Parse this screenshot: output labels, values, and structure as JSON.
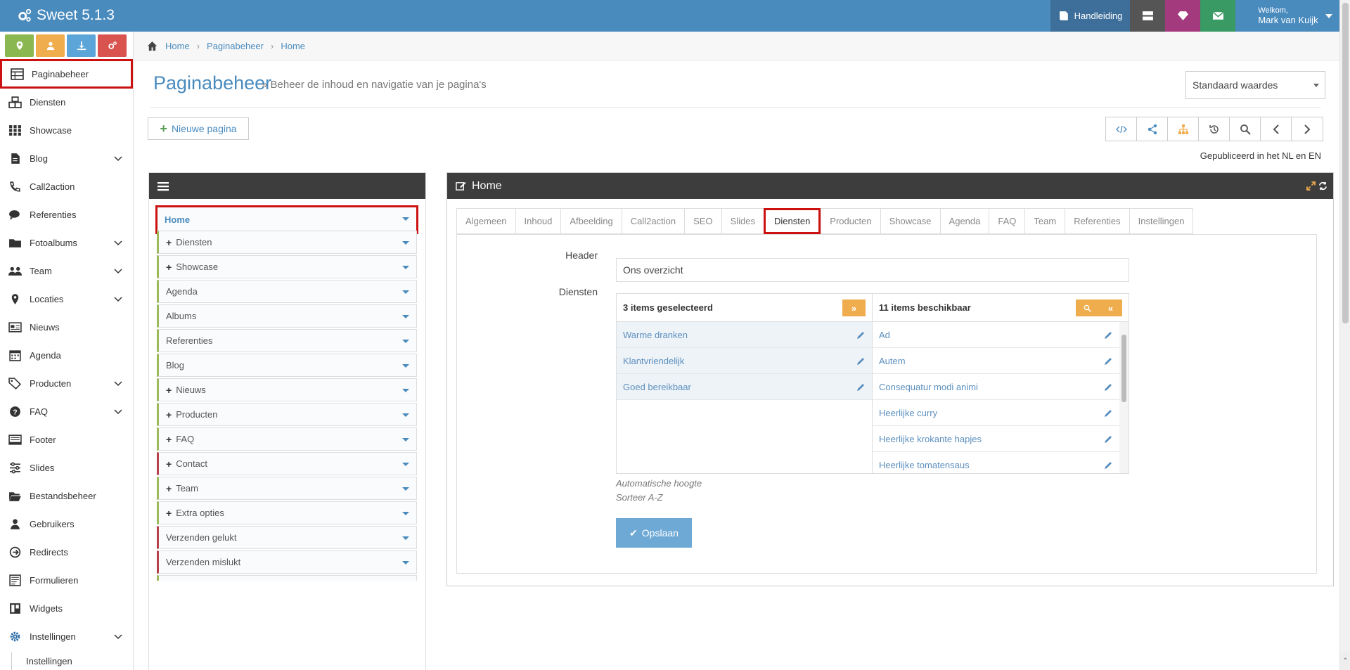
{
  "app": {
    "title": "Sweet 5.1.3"
  },
  "topbar": {
    "manual_label": "Handleiding",
    "welcome": "Welkom,",
    "user_name": "Mark van Kuijk",
    "colors": {
      "manual": "#3e6f9a",
      "server": "#555555",
      "brand": "#a43a7e",
      "mail": "#3a9a63"
    }
  },
  "sidebar": {
    "quick_buttons": [
      {
        "icon": "map-marker-icon",
        "color": "#8ab74f"
      },
      {
        "icon": "user-icon",
        "color": "#f0ad4e"
      },
      {
        "icon": "download-icon",
        "color": "#5ba5d8"
      },
      {
        "icon": "cogs-icon",
        "color": "#d9534f"
      }
    ],
    "items": [
      {
        "label": "Paginabeheer",
        "icon": "table-icon"
      },
      {
        "label": "Diensten",
        "icon": "cubes-icon"
      },
      {
        "label": "Showcase",
        "icon": "grid-icon"
      },
      {
        "label": "Blog",
        "icon": "file-icon"
      },
      {
        "label": "Call2action",
        "icon": "phone-icon"
      },
      {
        "label": "Referenties",
        "icon": "comments-icon"
      },
      {
        "label": "Fotoalbums",
        "icon": "folder-icon"
      },
      {
        "label": "Team",
        "icon": "users-icon"
      },
      {
        "label": "Locaties",
        "icon": "map-marker-icon"
      },
      {
        "label": "Nieuws",
        "icon": "newspaper-icon"
      },
      {
        "label": "Agenda",
        "icon": "calendar-icon"
      },
      {
        "label": "Producten",
        "icon": "tags-icon"
      },
      {
        "label": "FAQ",
        "icon": "question-icon"
      },
      {
        "label": "Footer",
        "icon": "footer-icon"
      },
      {
        "label": "Slides",
        "icon": "sliders-icon"
      },
      {
        "label": "Bestandsbeheer",
        "icon": "folder-open-icon"
      },
      {
        "label": "Gebruikers",
        "icon": "user-icon"
      },
      {
        "label": "Redirects",
        "icon": "redirect-icon"
      },
      {
        "label": "Formulieren",
        "icon": "form-icon"
      },
      {
        "label": "Widgets",
        "icon": "widgets-icon"
      },
      {
        "label": "Instellingen",
        "icon": "cog-icon"
      }
    ],
    "sub_item": "Instellingen"
  },
  "breadcrumb": [
    "Home",
    "Paginabeheer",
    "Home"
  ],
  "page": {
    "title": "Paginabeheer",
    "subtitle": "» Beheer de inhoud en navigatie van je pagina's",
    "select_value": "Standaard waardes",
    "new_page_label": "Nieuwe pagina",
    "published": "Gepubliceerd in het NL en EN"
  },
  "tree": {
    "items": [
      {
        "label": "Home"
      },
      {
        "label": "Diensten",
        "plus": true
      },
      {
        "label": "Showcase",
        "plus": true
      },
      {
        "label": "Agenda"
      },
      {
        "label": "Albums"
      },
      {
        "label": "Referenties"
      },
      {
        "label": "Blog"
      },
      {
        "label": "Nieuws",
        "plus": true
      },
      {
        "label": "Producten",
        "plus": true
      },
      {
        "label": "FAQ",
        "plus": true
      },
      {
        "label": "Contact",
        "plus": true
      },
      {
        "label": "Team",
        "plus": true
      },
      {
        "label": "Extra opties",
        "plus": true
      },
      {
        "label": "Verzenden gelukt"
      },
      {
        "label": "Verzenden mislukt"
      }
    ]
  },
  "editor": {
    "title": "Home",
    "tabs": [
      "Algemeen",
      "Inhoud",
      "Afbeelding",
      "Call2action",
      "SEO",
      "Slides",
      "Diensten",
      "Producten",
      "Showcase",
      "Agenda",
      "FAQ",
      "Team",
      "Referenties",
      "Instellingen"
    ],
    "active_tab": "Diensten",
    "header_label": "Header",
    "header_value": "Ons overzicht",
    "diensten_label": "Diensten",
    "selected_title": "3 items geselecteerd",
    "selected": [
      "Warme dranken",
      "Klantvriendelijk",
      "Goed bereikbaar"
    ],
    "available_title": "11 items beschikbaar",
    "available": [
      "Ad",
      "Autem",
      "Consequatur modi animi",
      "Heerlijke curry",
      "Heerlijke krokante hapjes",
      "Heerlijke tomatensaus"
    ],
    "hint1": "Automatische hoogte",
    "hint2": "Sorteer A-Z",
    "save_label": "Opslaan"
  }
}
